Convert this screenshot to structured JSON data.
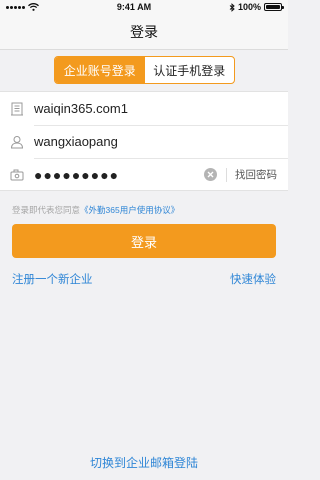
{
  "status_bar": {
    "time": "9:41 AM",
    "battery_text": "100%",
    "battery_level": 1.0
  },
  "nav": {
    "title": "登录"
  },
  "tabs": [
    {
      "label": "企业账号登录",
      "active": true
    },
    {
      "label": "认证手机登录",
      "active": false
    }
  ],
  "form": {
    "company_value": "waiqin365.com1",
    "username_value": "wangxiaopang",
    "password_value": "●●●●●●●●●",
    "forgot_label": "找回密码"
  },
  "agreement": {
    "prefix": "登录即代表您同意",
    "link": "《外勤365用户使用协议》"
  },
  "login_button": "登录",
  "links": {
    "register": "注册一个新企业",
    "trial": "快速体验",
    "switch_email": "切换到企业邮箱登陆"
  },
  "colors": {
    "accent": "#f39a1e",
    "link": "#2f86d6",
    "background": "#f1f1f3"
  },
  "icons": {
    "company": "building-icon",
    "user": "user-icon",
    "password": "camera-lock-icon",
    "clear": "clear-icon"
  }
}
